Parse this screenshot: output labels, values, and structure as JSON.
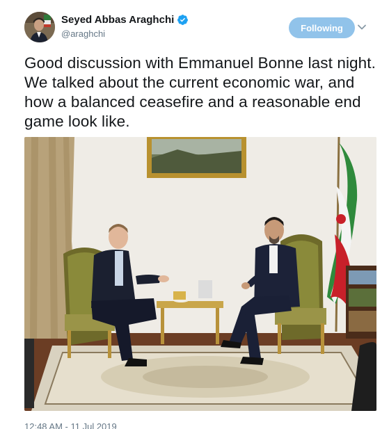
{
  "author": {
    "display_name": "Seyed Abbas Araghchi",
    "handle": "@araghchi",
    "verified": true,
    "avatar_icon": "profile-photo"
  },
  "follow_button": {
    "label": "Following"
  },
  "tweet": {
    "text": "Good discussion with Emmanuel Bonne last night. We talked about the current economic war, and how a balanced ceasefire and a reasonable end game look like.",
    "timestamp": "12:48 AM - 11 Jul 2019"
  },
  "media": {
    "type": "photo"
  },
  "colors": {
    "accent": "#1da1f2",
    "follow_button_bg": "#91c3ea",
    "secondary_text": "#657786"
  }
}
